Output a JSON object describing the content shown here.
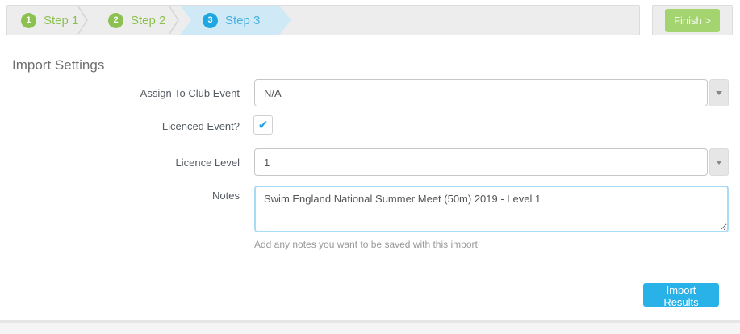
{
  "wizard": {
    "steps": [
      {
        "number": "1",
        "label": "Step 1",
        "state": "completed"
      },
      {
        "number": "2",
        "label": "Step 2",
        "state": "completed"
      },
      {
        "number": "3",
        "label": "Step 3",
        "state": "active"
      }
    ],
    "finish_button": "Finish >"
  },
  "page": {
    "heading": "Import Settings"
  },
  "form": {
    "assign_to_club_event": {
      "label": "Assign To Club Event",
      "value": "N/A",
      "type": "select"
    },
    "licenced_event": {
      "label": "Licenced Event?",
      "checked": true
    },
    "licence_level": {
      "label": "Licence Level",
      "value": "1",
      "type": "select"
    },
    "notes": {
      "label": "Notes",
      "value": "Swim England National Summer Meet (50m) 2019 - Level 1",
      "help": "Add any notes you want to be saved with this import"
    }
  },
  "actions": {
    "import_button": "Import Results"
  },
  "icons": {
    "check": "✔"
  },
  "colors": {
    "step_green": "#8cc152",
    "step_blue": "#1ea6e0",
    "step_active_bg": "#cfe9f7",
    "stepper_bg": "#ededed",
    "finish_button_bg": "#a3d470",
    "import_button_bg": "#29b2e8",
    "checkbox_check": "#1da2e8",
    "textarea_focus_border": "#a8dbf5"
  }
}
